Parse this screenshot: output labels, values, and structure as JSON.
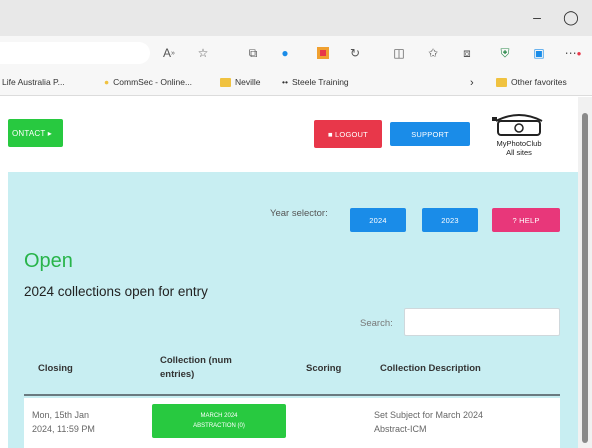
{
  "window": {
    "minimize": "–",
    "restore": "◯"
  },
  "toolbar": {
    "icons": [
      "read-aloud-icon",
      "favorite-star-icon",
      "extension-icon",
      "cloud-icon",
      "office-icon",
      "refresh-icon",
      "split-screen-icon",
      "favorites-icon",
      "collections-icon",
      "shield-icon",
      "sidebar-icon",
      "more-icon"
    ]
  },
  "favorites": {
    "items": [
      "Life Australia P...",
      "CommSec - Online...",
      "Neville",
      "Steele Training"
    ],
    "chevron": "›",
    "other": "Other favorites"
  },
  "header": {
    "contact_label": "ONTACT ▸",
    "logout_label": "■ LOGOUT",
    "support_label": "SUPPORT",
    "logo_line1": "MyPhotoClub",
    "logo_line2": "All sites"
  },
  "main": {
    "year_selector_label": "Year selector:",
    "year_buttons": [
      "2024",
      "2023"
    ],
    "help_label": "? HELP",
    "title": "Open",
    "subtitle": "2024 collections open for entry",
    "search_label": "Search:",
    "search_value": "",
    "table": {
      "headers": [
        "Closing",
        "Collection (num entries)",
        "Scoring",
        "Collection Description"
      ],
      "rows": [
        {
          "closing_line1": "Mon, 15th Jan",
          "closing_line2": "2024, 11:59 PM",
          "collection_line1": "MARCH 2024",
          "collection_line2": "ABSTRACTION (0)",
          "scoring": "",
          "description_line1": "Set Subject for March 2024",
          "description_line2": "Abstract-ICM"
        }
      ]
    }
  },
  "colors": {
    "green": "#28c940",
    "red": "#e8374a",
    "blue": "#1a8ce8",
    "pink": "#e8377a",
    "panel": "#c8eef2"
  }
}
